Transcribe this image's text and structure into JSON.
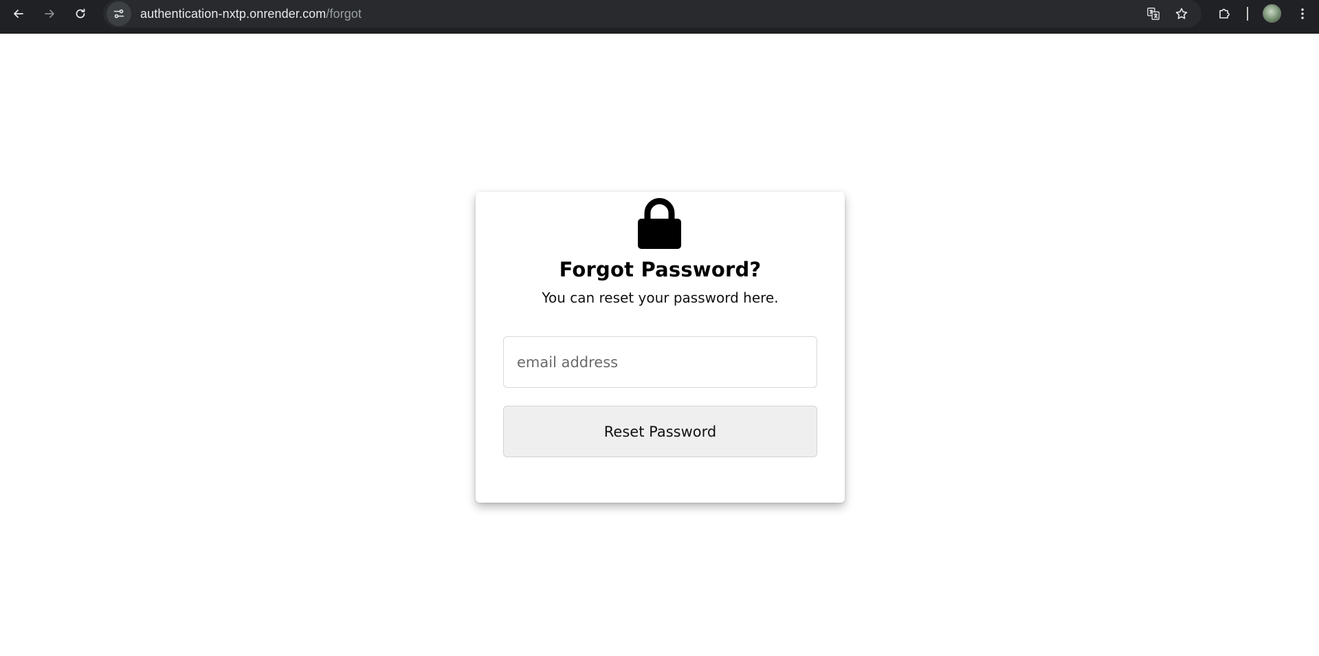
{
  "browser": {
    "url_host": "authentication-nxtp.onrender.com",
    "url_path": "/forgot",
    "icons": {
      "back": "back-arrow-icon",
      "forward": "forward-arrow-icon",
      "reload": "reload-icon",
      "site_info": "tune-icon",
      "translate": "translate-icon",
      "bookmark": "star-icon",
      "extensions": "puzzle-icon",
      "menu": "kebab-menu-icon"
    },
    "colors": {
      "toolbar_bg": "#202124",
      "omnibox_bg": "#282a2d",
      "url_text": "#e8eaed",
      "url_path_text": "#9aa0a6"
    }
  },
  "card": {
    "icon": "lock-icon",
    "title": "Forgot Password?",
    "subtitle": "You can reset your password here.",
    "email": {
      "placeholder": "email address",
      "value": ""
    },
    "reset_button_label": "Reset Password"
  }
}
